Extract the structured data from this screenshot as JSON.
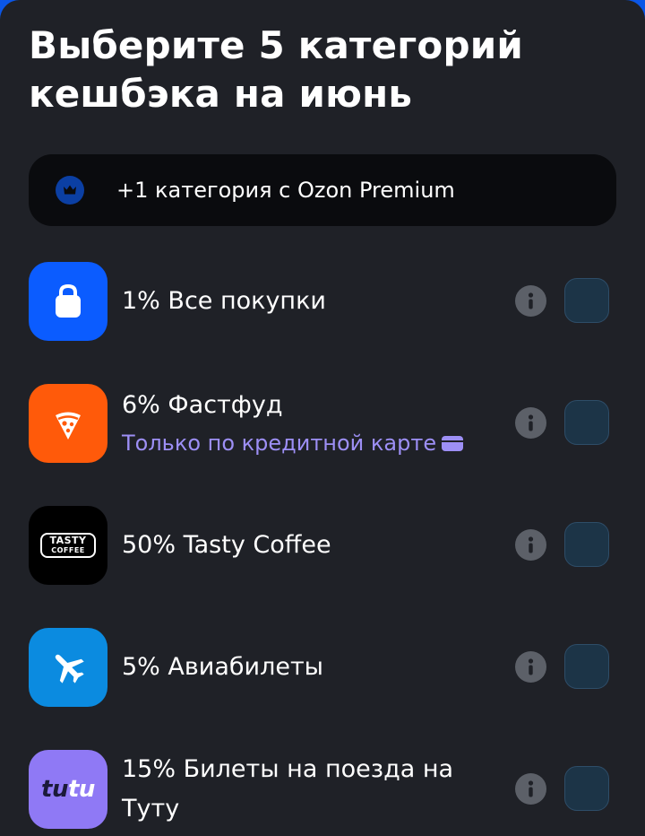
{
  "page": {
    "title": "Выберите 5 категорий кешбэка на июнь"
  },
  "premium_banner": {
    "icon": "crown-icon",
    "text": "+1 категория с Ozon Premium"
  },
  "categories": [
    {
      "icon": "shopping-bag-icon",
      "icon_color": "#0b5cff",
      "title": "1% Все покупки",
      "subtitle": null,
      "checked": false
    },
    {
      "icon": "pizza-slice-icon",
      "icon_color": "#ff5a0a",
      "title": "6% Фастфуд",
      "subtitle": "Только по кредитной карте",
      "subtitle_icon": "credit-card-icon",
      "checked": false
    },
    {
      "icon": "tasty-coffee-logo",
      "icon_color": "#000000",
      "logo_line1": "TASTY",
      "logo_line2": "COFFEE",
      "title": "50% Tasty Coffee",
      "subtitle": null,
      "checked": false
    },
    {
      "icon": "airplane-icon",
      "icon_color": "#0b8be0",
      "title": "5% Авиабилеты",
      "subtitle": null,
      "checked": false
    },
    {
      "icon": "tutu-logo",
      "icon_color": "#8f79f5",
      "logo_part1": "tu",
      "logo_part2": "tu",
      "title": "15% Билеты на поезда на",
      "title_line2": "Туту",
      "subtitle": null,
      "checked": false
    }
  ],
  "colors": {
    "background": "#1f2127",
    "banner_bg": "#0a0b0e",
    "subtitle_accent": "#9d8ff5",
    "checkbox_bg": "#1c3447",
    "info_button": "#5c6068"
  }
}
